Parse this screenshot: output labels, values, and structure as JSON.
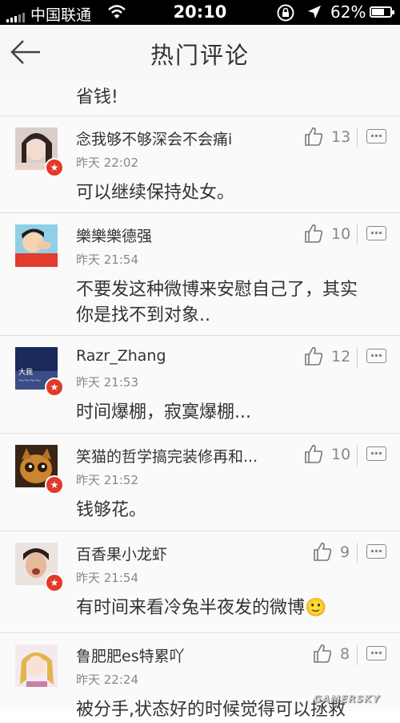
{
  "status_bar": {
    "carrier": "中国联通",
    "time": "20:10",
    "battery": "62%",
    "icons": [
      "signal-icon",
      "wifi-icon",
      "rotation-lock-icon",
      "location-icon",
      "battery-icon"
    ],
    "battery_level": 0.62
  },
  "nav": {
    "title": "热门评论",
    "back_icon": "back-arrow-icon"
  },
  "previous_comment_tail": "省钱!",
  "comments": [
    {
      "name": "念我够不够深会不会痛i",
      "time": "昨天 22:02",
      "text": "可以继续保持处女。",
      "likes": "13",
      "verified": true
    },
    {
      "name": "樂樂樂德强",
      "time": "昨天 21:54",
      "text": "不要发这种微博来安慰自己了，其实你是找不到对象..",
      "likes": "10",
      "verified": false
    },
    {
      "name": "Razr_Zhang",
      "time": "昨天 21:53",
      "text": "时间爆棚，寂寞爆棚...",
      "likes": "12",
      "verified": true
    },
    {
      "name": "笑猫的哲学搞完装修再和...",
      "time": "昨天 21:52",
      "text": "钱够花。",
      "likes": "10",
      "verified": true
    },
    {
      "name": "百香果小龙虾",
      "time": "昨天 21:54",
      "text": "有时间来看冷兔半夜发的微博🙂",
      "likes": "9",
      "verified": true
    },
    {
      "name": "鲁肥肥es特累吖",
      "time": "昨天 22:24",
      "text": "被分手,状态好的时候觉得可以拯救",
      "likes": "8",
      "verified": false
    }
  ],
  "watermark": "GAMERSKY",
  "colors": {
    "badge": "#e23a2a",
    "nav_bg": "#f7f7f7",
    "row_bg": "#fafafa"
  }
}
